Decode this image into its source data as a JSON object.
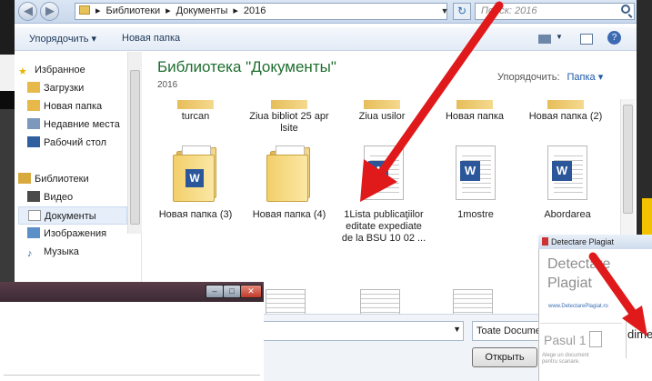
{
  "explorer": {
    "breadcrumb": [
      "Библиотеки",
      "Документы",
      "2016"
    ],
    "search_placeholder": "Поиск: 2016",
    "toolbar": {
      "organize": "Упорядочить",
      "new_folder": "Новая папка"
    },
    "library_title": "Библиотека \"Документы\"",
    "library_subtitle": "2016",
    "arrange_label": "Упорядочить:",
    "arrange_value": "Папка",
    "sidebar": {
      "favorites": "Избранное",
      "fav_items": [
        "Загрузки",
        "Новая папка",
        "Недавние места",
        "Рабочий стол"
      ],
      "libraries": "Библиотеки",
      "lib_items": [
        "Видео",
        "Документы",
        "Изображения",
        "Музыка"
      ]
    },
    "top_row": [
      "turcan",
      "Ziua bibliot 25 apr lsite",
      "Ziua usilor",
      "Новая папка",
      "Новая папка (2)"
    ],
    "items": [
      "Новая папка (3)",
      "Новая папка (4)",
      "1Lista publicaţiilor editate expediate de la BSU 10 02 ...",
      "1mostre",
      "Abordarea"
    ],
    "filter_value": "Toate Documentele",
    "open_button": "Открыть"
  },
  "plagiat": {
    "title": "Detectare Plagiat",
    "heading_1": "Detectare",
    "heading_2": "Plagiat",
    "url": "www.DetectarePlagiat.ro",
    "step": "Pasul 1",
    "hint": "Alege un document pentru scanare.",
    "partial": "dime"
  },
  "colors": {
    "arrow": "#e0191b",
    "library_title": "#1e6e2f",
    "link": "#1e5aa8"
  }
}
